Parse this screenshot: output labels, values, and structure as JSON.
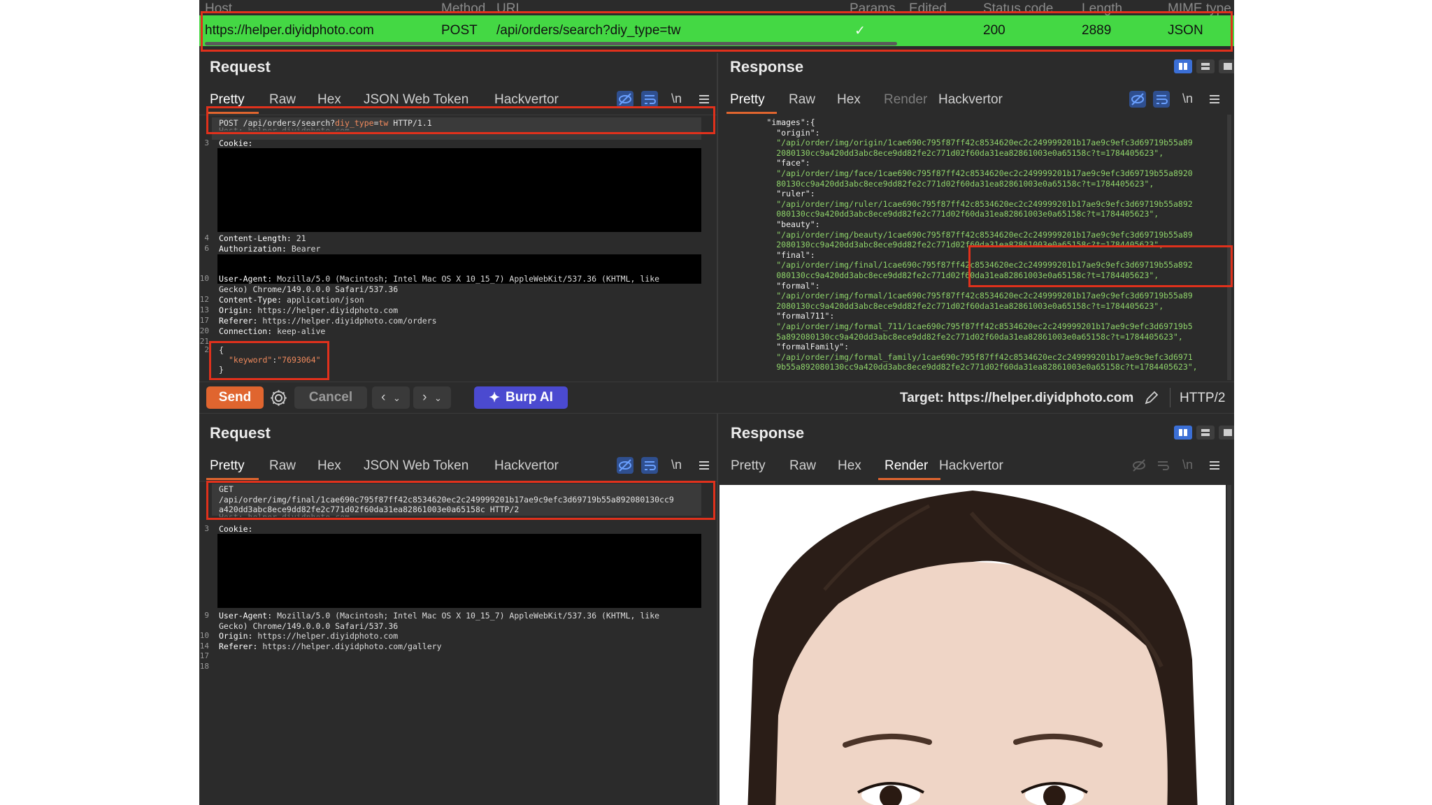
{
  "history": {
    "columns": {
      "host": "Host",
      "method": "Method",
      "url": "URL",
      "params": "Params",
      "edited": "Edited",
      "status": "Status code",
      "length": "Length",
      "mime": "MIME type"
    },
    "row": {
      "host": "https://helper.diyidphoto.com",
      "method": "POST",
      "url": "/api/orders/search?diy_type=tw",
      "params": "✓",
      "status": "200",
      "length": "2889",
      "mime": "JSON"
    }
  },
  "top": {
    "request": {
      "title": "Request",
      "tabs": [
        "Pretty",
        "Raw",
        "Hex",
        "JSON Web Token",
        "Hackvertor"
      ],
      "newline_label": "\\n",
      "line1_a": "POST /api/orders/search?",
      "line1_b": "diy_type",
      "line1_c": "=",
      "line1_d": "tw",
      "line1_e": " HTTP/1.1",
      "host_line": "Host: helper.diyidphoto.com",
      "cookie_ln": "3",
      "cookie_k": "Cookie:",
      "cl_ln": "4",
      "cl_k": "Content-Length:",
      "cl_v": " 21",
      "auth_ln": "6",
      "auth_k": "Authorization:",
      "auth_v": " Bearer",
      "ua_ln": "10",
      "ua_k": "User-Agent:",
      "ua_v": " Mozilla/5.0 (Macintosh; Intel Mac OS X 10_15_7) AppleWebKit/537.36 (KHTML, like",
      "ua_v2": "Gecko) Chrome/149.0.0.0 Safari/537.36",
      "ct_ln": "12",
      "ct_k": "Content-Type:",
      "ct_v": " application/json",
      "or_ln": "13",
      "or_k": "Origin:",
      "or_v": " https://helper.diyidphoto.com",
      "rf_ln": "17",
      "rf_k": "Referer:",
      "rf_v": " https://helper.diyidphoto.com/orders",
      "cn_ln": "20",
      "cn_k": "Connection:",
      "cn_v": " keep-alive",
      "ln21": "21",
      "ln22": "2",
      "body_open": "{",
      "body_key": "\"keyword\"",
      "body_colon": ":",
      "body_val": "\"7693064\"",
      "body_close": "}"
    },
    "response": {
      "title": "Response",
      "tabs": [
        "Pretty",
        "Raw",
        "Hex",
        "Render",
        "Hackvertor"
      ],
      "newline_label": "\\n",
      "lines": [
        {
          "t": "key",
          "indent": "    ",
          "text": "\"images\":{"
        },
        {
          "t": "key",
          "indent": "      ",
          "text": "\"origin\":"
        },
        {
          "t": "str",
          "indent": "      ",
          "text": "\"/api/order/img/origin/1cae690c795f87ff42c8534620ec2c249999201b17ae9c9efc3d69719b55a89"
        },
        {
          "t": "str",
          "indent": "      ",
          "text": "2080130cc9a420dd3abc8ece9dd82fe2c771d02f60da31ea82861003e0a65158c?t=1784405623\","
        },
        {
          "t": "key",
          "indent": "      ",
          "text": "\"face\":"
        },
        {
          "t": "str",
          "indent": "      ",
          "text": "\"/api/order/img/face/1cae690c795f87ff42c8534620ec2c249999201b17ae9c9efc3d69719b55a8920"
        },
        {
          "t": "str",
          "indent": "      ",
          "text": "80130cc9a420dd3abc8ece9dd82fe2c771d02f60da31ea82861003e0a65158c?t=1784405623\","
        },
        {
          "t": "key",
          "indent": "      ",
          "text": "\"ruler\":"
        },
        {
          "t": "str",
          "indent": "      ",
          "text": "\"/api/order/img/ruler/1cae690c795f87ff42c8534620ec2c249999201b17ae9c9efc3d69719b55a892"
        },
        {
          "t": "str",
          "indent": "      ",
          "text": "080130cc9a420dd3abc8ece9dd82fe2c771d02f60da31ea82861003e0a65158c?t=1784405623\","
        },
        {
          "t": "key",
          "indent": "      ",
          "text": "\"beauty\":"
        },
        {
          "t": "str",
          "indent": "      ",
          "text": "\"/api/order/img/beauty/1cae690c795f87ff42c8534620ec2c249999201b17ae9c9efc3d69719b55a89"
        },
        {
          "t": "str",
          "indent": "      ",
          "text": "2080130cc9a420dd3abc8ece9dd82fe2c771d02f60da31ea82861003e0a65158c?t=1784405623\","
        },
        {
          "t": "key",
          "indent": "      ",
          "text": "\"final\":"
        },
        {
          "t": "str",
          "indent": "      ",
          "text": "\"/api/order/img/final/1cae690c795f87ff42c8534620ec2c249999201b17ae9c9efc3d69719b55a892"
        },
        {
          "t": "str",
          "indent": "      ",
          "text": "080130cc9a420dd3abc8ece9dd82fe2c771d02f60da31ea82861003e0a65158c?t=1784405623\","
        },
        {
          "t": "key",
          "indent": "      ",
          "text": "\"formal\":"
        },
        {
          "t": "str",
          "indent": "      ",
          "text": "\"/api/order/img/formal/1cae690c795f87ff42c8534620ec2c249999201b17ae9c9efc3d69719b55a89"
        },
        {
          "t": "str",
          "indent": "      ",
          "text": "2080130cc9a420dd3abc8ece9dd82fe2c771d02f60da31ea82861003e0a65158c?t=1784405623\","
        },
        {
          "t": "key",
          "indent": "      ",
          "text": "\"formal711\":"
        },
        {
          "t": "str",
          "indent": "      ",
          "text": "\"/api/order/img/formal_711/1cae690c795f87ff42c8534620ec2c249999201b17ae9c9efc3d69719b5"
        },
        {
          "t": "str",
          "indent": "      ",
          "text": "5a892080130cc9a420dd3abc8ece9dd82fe2c771d02f60da31ea82861003e0a65158c?t=1784405623\","
        },
        {
          "t": "key",
          "indent": "      ",
          "text": "\"formalFamily\":"
        },
        {
          "t": "str",
          "indent": "      ",
          "text": "\"/api/order/img/formal_family/1cae690c795f87ff42c8534620ec2c249999201b17ae9c9efc3d6971"
        },
        {
          "t": "str",
          "indent": "      ",
          "text": "9b55a892080130cc9a420dd3abc8ece9dd82fe2c771d02f60da31ea82861003e0a65158c?t=1784405623\","
        }
      ]
    }
  },
  "toolbar": {
    "send": "Send",
    "cancel": "Cancel",
    "burp_ai": "Burp AI",
    "target": "Target: https://helper.diyidphoto.com",
    "protocol": "HTTP/2"
  },
  "bottom": {
    "request": {
      "title": "Request",
      "tabs": [
        "Pretty",
        "Raw",
        "Hex",
        "JSON Web Token",
        "Hackvertor"
      ],
      "newline_label": "\\n",
      "get": "GET",
      "path1": "/api/order/img/final/1cae690c795f87ff42c8534620ec2c249999201b17ae9c9efc3d69719b55a892080130cc9",
      "path2": "a420dd3abc8ece9dd82fe2c771d02f60da31ea82861003e0a65158c HTTP/2",
      "host_line": "Host: helper.diyidphoto.com",
      "cookie_ln": "3",
      "cookie_k": "Cookie:",
      "ua_ln": "9",
      "ua_k": "User-Agent:",
      "ua_v": " Mozilla/5.0 (Macintosh; Intel Mac OS X 10_15_7) AppleWebKit/537.36 (KHTML, like",
      "ua_v2": "Gecko) Chrome/149.0.0.0 Safari/537.36",
      "or_ln": "10",
      "or_k": "Origin:",
      "or_v": " https://helper.diyidphoto.com",
      "rf_ln": "14",
      "rf_k": "Referer:",
      "rf_v": " https://helper.diyidphoto.com/gallery",
      "ln17": "17",
      "ln18": "18"
    },
    "response": {
      "title": "Response",
      "tabs": [
        "Pretty",
        "Raw",
        "Hex",
        "Render",
        "Hackvertor"
      ],
      "newline_label": "\\n"
    }
  },
  "colors": {
    "accent": "#e0652f",
    "highlight": "#e0311c",
    "row_green": "#44d844",
    "send": "#e0652f",
    "burp_ai": "#4b4ad0",
    "active_blue": "#3b6fd6"
  }
}
